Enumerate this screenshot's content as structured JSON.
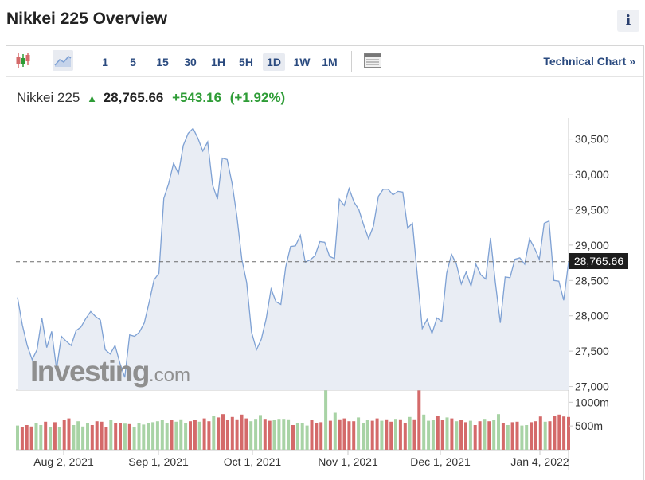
{
  "header": {
    "title": "Nikkei 225 Overview",
    "info_icon": "i"
  },
  "toolbar": {
    "chart_type_icons": [
      "candlestick-icon",
      "area-chart-icon"
    ],
    "intervals": [
      "1",
      "5",
      "15",
      "30",
      "1H",
      "5H",
      "1D",
      "1W",
      "1M"
    ],
    "active_interval": "1D",
    "table_icon": "table-icon",
    "technical_chart": "Technical Chart",
    "technical_chevron": "»"
  },
  "quote": {
    "name": "Nikkei 225",
    "price": "28,765.66",
    "change": "+543.16",
    "change_pct": "(+1.92%)"
  },
  "colors": {
    "line": "#7ea1d4",
    "fill": "#e9edf4",
    "up": "#a8d3a5",
    "down": "#d46a6a",
    "positive_text": "#2e9c36",
    "link": "#2a4a7f"
  },
  "watermark": "Investing.com",
  "chart_data": {
    "type": "area",
    "x_ticks": [
      "Aug 2, 2021",
      "Sep 1, 2021",
      "Oct 1, 2021",
      "Nov 1, 2021",
      "Dec 1, 2021",
      "Jan 4, 2022"
    ],
    "y_ticks": [
      "30,500",
      "30,000",
      "29,500",
      "29,000",
      "28,500",
      "28,000",
      "27,500",
      "27,000"
    ],
    "y_tick_values": [
      30500,
      30000,
      29500,
      29000,
      28500,
      28000,
      27500,
      27000
    ],
    "ylim": [
      26950,
      30800
    ],
    "last_price": 28765.66,
    "last_price_label": "28,765.66",
    "price_values": [
      28260,
      27870,
      27580,
      27380,
      27520,
      27970,
      27550,
      27780,
      27250,
      27710,
      27640,
      27580,
      27790,
      27840,
      27960,
      28060,
      27990,
      27940,
      27520,
      27460,
      27580,
      27330,
      27130,
      27730,
      27710,
      27770,
      27900,
      28190,
      28510,
      28600,
      29660,
      29870,
      30160,
      30010,
      30410,
      30580,
      30650,
      30510,
      30330,
      30460,
      29850,
      29650,
      30230,
      30210,
      29870,
      29400,
      28800,
      28470,
      27770,
      27520,
      27670,
      27960,
      28380,
      28200,
      28160,
      28690,
      28980,
      28990,
      29140,
      28760,
      28790,
      28850,
      29050,
      29040,
      28840,
      28810,
      29650,
      29560,
      29800,
      29610,
      29500,
      29280,
      29090,
      29270,
      29690,
      29790,
      29790,
      29710,
      29760,
      29750,
      29240,
      29310,
      28560,
      27820,
      27950,
      27750,
      27970,
      27920,
      28600,
      28870,
      28730,
      28450,
      28620,
      28420,
      28730,
      28580,
      28520,
      29100,
      28470,
      27900,
      28550,
      28540,
      28800,
      28820,
      28730,
      29090,
      28960,
      28800,
      29310,
      29340,
      28500,
      28490,
      28220,
      28760
    ],
    "volume_unit_ticks": [
      "1000m",
      "500m"
    ],
    "volume_tick_values": [
      1000,
      500
    ],
    "volume_max": 1240,
    "volume_values": [
      510,
      480,
      520,
      490,
      560,
      520,
      590,
      480,
      580,
      480,
      620,
      660,
      520,
      600,
      490,
      570,
      520,
      600,
      590,
      480,
      630,
      570,
      560,
      550,
      540,
      480,
      570,
      530,
      560,
      580,
      600,
      620,
      560,
      630,
      590,
      640,
      570,
      600,
      620,
      590,
      660,
      600,
      710,
      680,
      750,
      620,
      690,
      640,
      740,
      660,
      600,
      650,
      730,
      650,
      610,
      620,
      650,
      650,
      640,
      520,
      560,
      560,
      510,
      620,
      560,
      580,
      1250,
      610,
      780,
      640,
      660,
      600,
      600,
      680,
      560,
      620,
      610,
      660,
      610,
      640,
      590,
      650,
      640,
      560,
      690,
      640,
      1250,
      740,
      610,
      620,
      720,
      630,
      680,
      660,
      600,
      620,
      580,
      610,
      520,
      600,
      650,
      600,
      620,
      750,
      560,
      520,
      580,
      590,
      510,
      520,
      580,
      600,
      700,
      590,
      600,
      720,
      740,
      700,
      690
    ],
    "volume_up": [
      1,
      0,
      0,
      0,
      1,
      1,
      0,
      1,
      0,
      1,
      0,
      0,
      1,
      1,
      1,
      1,
      0,
      0,
      0,
      0,
      1,
      0,
      0,
      1,
      0,
      1,
      1,
      1,
      1,
      1,
      1,
      1,
      1,
      0,
      1,
      1,
      1,
      0,
      0,
      1,
      0,
      0,
      1,
      0,
      0,
      0,
      0,
      0,
      0,
      0,
      1,
      1,
      1,
      0,
      0,
      1,
      1,
      1,
      1,
      0,
      1,
      1,
      1,
      0,
      0,
      0,
      1,
      0,
      1,
      0,
      0,
      0,
      0,
      1,
      1,
      1,
      0,
      0,
      1,
      0,
      0,
      1,
      0,
      0,
      1,
      0,
      0,
      1,
      1,
      1,
      0,
      0,
      1,
      0,
      1,
      0,
      0,
      1,
      0,
      0,
      1,
      0,
      1,
      1,
      0,
      1,
      0,
      0,
      1,
      1,
      0,
      0,
      0,
      1
    ]
  }
}
